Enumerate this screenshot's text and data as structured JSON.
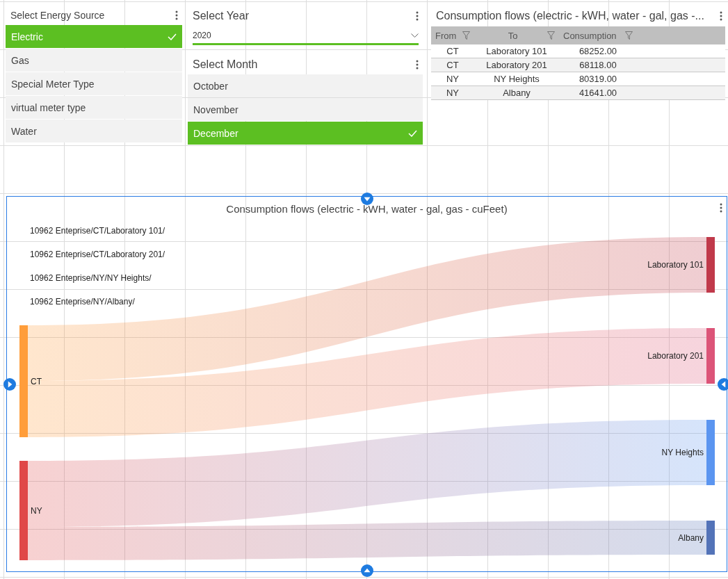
{
  "energy_source": {
    "title": "Select Energy Source",
    "items": [
      {
        "label": "Electric",
        "selected": true
      },
      {
        "label": "Gas",
        "selected": false
      },
      {
        "label": "Special Meter Type",
        "selected": false
      },
      {
        "label": "virtual meter type",
        "selected": false
      },
      {
        "label": "Water",
        "selected": false
      }
    ]
  },
  "year": {
    "title": "Select Year",
    "value": "2020"
  },
  "month": {
    "title": "Select Month",
    "items": [
      {
        "label": "October",
        "selected": false
      },
      {
        "label": "November",
        "selected": false
      },
      {
        "label": "December",
        "selected": true
      }
    ]
  },
  "table": {
    "title": "Consumption flows (electric - kWH, water - gal, gas -...",
    "columns": [
      "From",
      "To",
      "Consumption"
    ],
    "rows": [
      [
        "CT",
        "Laboratory 101",
        "68252.00"
      ],
      [
        "CT",
        "Laboratory 201",
        "68118.00"
      ],
      [
        "NY",
        "NY Heights",
        "80319.00"
      ],
      [
        "NY",
        "Albany",
        "41641.00"
      ]
    ]
  },
  "sankey": {
    "title": "Consumption flows (electric - kWH, water - gal, gas - cuFeet)",
    "legend": [
      "10962 Enteprise/CT/Laboratory 101/",
      "10962 Enteprise/CT/Laboratory 201/",
      "10962 Enteprise/NY/NY Heights/",
      "10962 Enteprise/NY/Albany/"
    ],
    "sources": [
      {
        "label": "CT",
        "color": "#ff9d3a"
      },
      {
        "label": "NY",
        "color": "#e04848"
      }
    ],
    "targets": [
      {
        "label": "Laboratory 101",
        "color": "#c0394a"
      },
      {
        "label": "Laboratory 201",
        "color": "#dc5478"
      },
      {
        "label": "NY Heights",
        "color": "#5b95f0"
      },
      {
        "label": "Albany",
        "color": "#5373b8"
      }
    ]
  }
}
